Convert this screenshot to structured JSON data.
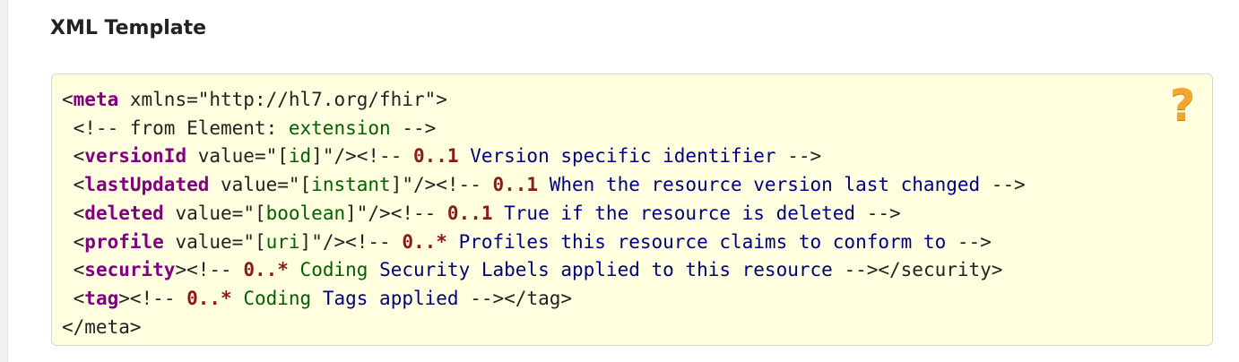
{
  "section": {
    "title": "XML Template"
  },
  "help_icon": {
    "glyph": "?",
    "name": "help-icon",
    "color": "#f3a52c"
  },
  "code": {
    "meta_open_lt": "<",
    "meta_tag": "meta",
    "meta_attr": " xmlns=\"http://hl7.org/fhir\">",
    "comment_prefix": " <!-- from Element: ",
    "comment_extension": "extension",
    "comment_suffix": " -->",
    "versionId": {
      "lt": " <",
      "tag": "versionId",
      "value_pre": " value=\"[",
      "type": "id",
      "value_post": "]\"/>",
      "c_open": "<!-- ",
      "card": "0..1",
      "desc": " Version specific identifier ",
      "c_close": "-->"
    },
    "lastUpdated": {
      "lt": " <",
      "tag": "lastUpdated",
      "value_pre": " value=\"[",
      "type": "instant",
      "value_post": "]\"/>",
      "c_open": "<!-- ",
      "card": "0..1",
      "desc": " When the resource version last changed ",
      "c_close": "-->"
    },
    "deleted": {
      "lt": " <",
      "tag": "deleted",
      "value_pre": " value=\"[",
      "type": "boolean",
      "value_post": "]\"/>",
      "c_open": "<!-- ",
      "card": "0..1",
      "desc": " True if the resource is deleted ",
      "c_close": "-->"
    },
    "profile": {
      "lt": " <",
      "tag": "profile",
      "value_pre": " value=\"[",
      "type": "uri",
      "value_post": "]\"/>",
      "c_open": "<!-- ",
      "card": "0..*",
      "desc": " Profiles this resource claims to conform to ",
      "c_close": "-->"
    },
    "security": {
      "lt": " <",
      "tag": "security",
      "after_tag": ">",
      "c_open": "<!-- ",
      "card": "0..*",
      "type": " Coding",
      "desc": " Security Labels applied to this resource ",
      "c_close": "-->",
      "close_tag": "</security>"
    },
    "tag_el": {
      "lt": " <",
      "tag": "tag",
      "after_tag": ">",
      "c_open": "<!-- ",
      "card": "0..*",
      "type": " Coding",
      "desc": " Tags applied ",
      "c_close": "-->",
      "close_tag": "</tag>"
    },
    "meta_close": "</meta>"
  }
}
